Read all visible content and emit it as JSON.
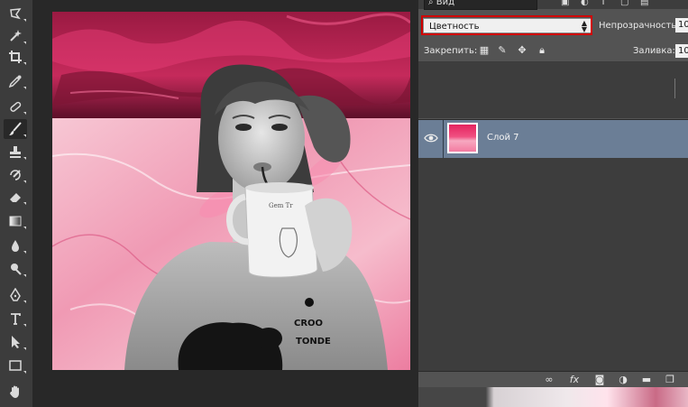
{
  "app": {
    "panel_filter": "Вид"
  },
  "layers_panel": {
    "blend_mode": "Цветность",
    "opacity_label": "Непрозрачность:",
    "opacity_value": "10",
    "lock_label": "Закрепить:",
    "fill_label": "Заливка:",
    "fill_value": "10",
    "layers": [
      {
        "name": "Слой 7",
        "visible": true,
        "selected": true
      }
    ],
    "bottom_icons": [
      "link-icon",
      "fx-icon",
      "mask-icon",
      "adjustment-icon",
      "folder-icon",
      "new-layer-icon"
    ]
  },
  "canvas": {
    "text_on_mug": "Gem Tr",
    "text_on_shirt": "CROO TONDE"
  },
  "colors": {
    "accent_pink": "#e4245f",
    "highlight_red": "#d10000",
    "selected_layer": "#6b7e96"
  },
  "tools": [
    "lasso-icon",
    "magic-wand-icon",
    "crop-icon",
    "eyedropper-icon",
    "healing-icon",
    "brush-icon",
    "stamp-icon",
    "history-brush-icon",
    "eraser-icon",
    "gradient-icon",
    "blur-icon",
    "dodge-icon",
    "pen-icon",
    "type-icon",
    "path-selection-icon",
    "rectangle-icon",
    "hand-icon"
  ]
}
